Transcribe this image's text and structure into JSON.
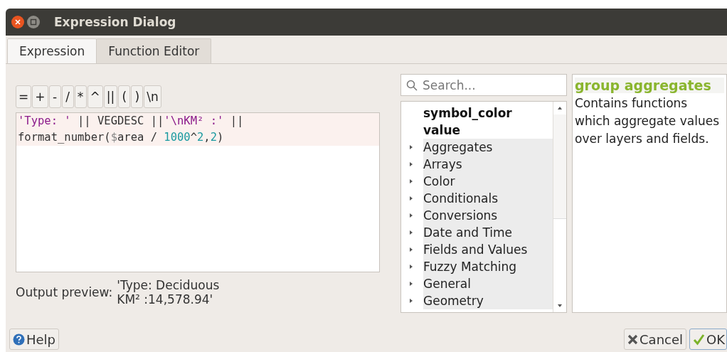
{
  "window": {
    "title": "Expression Dialog"
  },
  "tabs": [
    {
      "label": "Expression",
      "selected": true
    },
    {
      "label": "Function Editor",
      "selected": false
    }
  ],
  "operators": [
    "=",
    "+",
    "-",
    "/",
    "*",
    "^",
    "||",
    "(",
    ")",
    "\\n"
  ],
  "editor": {
    "lines": [
      [
        {
          "kind": "string",
          "text": "'Type: '"
        },
        {
          "kind": "plain",
          "text": " || VEGDESC ||"
        },
        {
          "kind": "string",
          "text": "'\\nKM² :'"
        },
        {
          "kind": "plain",
          "text": " ||"
        }
      ],
      [
        {
          "kind": "plain",
          "text": "format_number("
        },
        {
          "kind": "var",
          "text": "$"
        },
        {
          "kind": "plain",
          "text": "area / "
        },
        {
          "kind": "number",
          "text": "1000"
        },
        {
          "kind": "plain",
          "text": "^"
        },
        {
          "kind": "number",
          "text": "2"
        },
        {
          "kind": "plain",
          "text": ","
        },
        {
          "kind": "number",
          "text": "2"
        },
        {
          "kind": "plain",
          "text": ")"
        }
      ]
    ]
  },
  "output_preview": {
    "label": "Output preview:",
    "value_lines": [
      "'Type: Deciduous",
      "KM² :14,578.94'"
    ]
  },
  "search": {
    "placeholder": "Search..."
  },
  "tree": [
    {
      "label": "symbol_color value",
      "kind": "entry"
    },
    {
      "label": "Aggregates",
      "kind": "group"
    },
    {
      "label": "Arrays",
      "kind": "group"
    },
    {
      "label": "Color",
      "kind": "group"
    },
    {
      "label": "Conditionals",
      "kind": "group"
    },
    {
      "label": "Conversions",
      "kind": "group"
    },
    {
      "label": "Date and Time",
      "kind": "group"
    },
    {
      "label": "Fields and Values",
      "kind": "group"
    },
    {
      "label": "Fuzzy Matching",
      "kind": "group"
    },
    {
      "label": "General",
      "kind": "group"
    },
    {
      "label": "Geometry",
      "kind": "group"
    }
  ],
  "help_panel": {
    "title": "group aggregates",
    "text": "Contains functions which aggregate values over layers and fields."
  },
  "buttons": {
    "help": "Help",
    "cancel": "Cancel",
    "ok": "OK"
  }
}
